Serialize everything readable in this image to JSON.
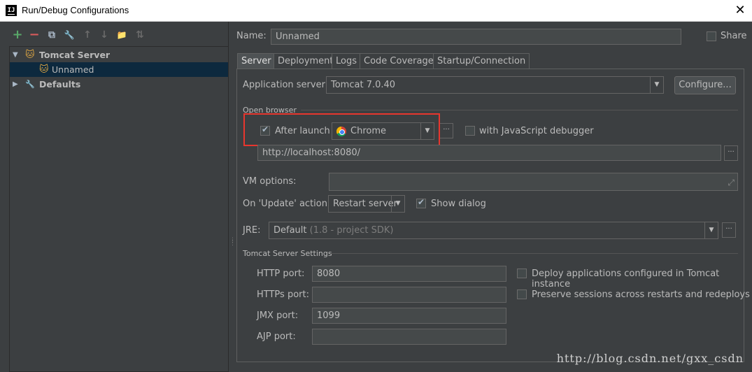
{
  "window": {
    "title": "Run/Debug Configurations",
    "app_icon": "IJ",
    "close": "✕"
  },
  "toolbar": {
    "add": "+",
    "remove": "−",
    "copy": "⧉",
    "edit_defaults": "🔧",
    "move_up": "↑",
    "move_down": "↓",
    "folder": "📁",
    "sort": "⇅"
  },
  "tree": {
    "items": [
      {
        "label": "Tomcat Server",
        "arrow": "▼"
      },
      {
        "label": "Unnamed"
      },
      {
        "label": "Defaults",
        "arrow": "▶"
      }
    ]
  },
  "name": {
    "label": "Name:",
    "value": "Unnamed",
    "share_label": "Share"
  },
  "tabs": [
    "Server",
    "Deployment",
    "Logs",
    "Code Coverage",
    "Startup/Connection"
  ],
  "server": {
    "app_server_label": "Application server:",
    "app_server_value": "Tomcat 7.0.40",
    "configure_label": "Configure...",
    "open_browser_title": "Open browser",
    "after_launch_label": "After launch",
    "browser_value": "Chrome",
    "js_debugger_label": "with JavaScript debugger",
    "url_value": "http://localhost:8080/",
    "vm_options_label": "VM options:",
    "on_update_label": "On 'Update' action:",
    "on_update_value": "Restart server",
    "show_dialog_label": "Show dialog",
    "jre_label": "JRE:",
    "jre_value": "Default",
    "jre_hint": "(1.8 - project SDK)",
    "tomcat_settings_title": "Tomcat Server Settings",
    "http_port_label": "HTTP port:",
    "http_port_value": "8080",
    "https_port_label": "HTTPs port:",
    "https_port_value": "",
    "jmx_port_label": "JMX port:",
    "jmx_port_value": "1099",
    "ajp_port_label": "AJP port:",
    "ajp_port_value": "",
    "deploy_label": "Deploy applications configured in Tomcat instance",
    "preserve_label": "Preserve sessions across restarts and redeploys",
    "dots": "···"
  },
  "watermark": "http://blog.csdn.net/gxx_csdn",
  "colors": {
    "highlight_box": "#e8362e",
    "add_icon": "#59a869",
    "remove_icon": "#db5c5c",
    "selection": "#0d293e"
  }
}
